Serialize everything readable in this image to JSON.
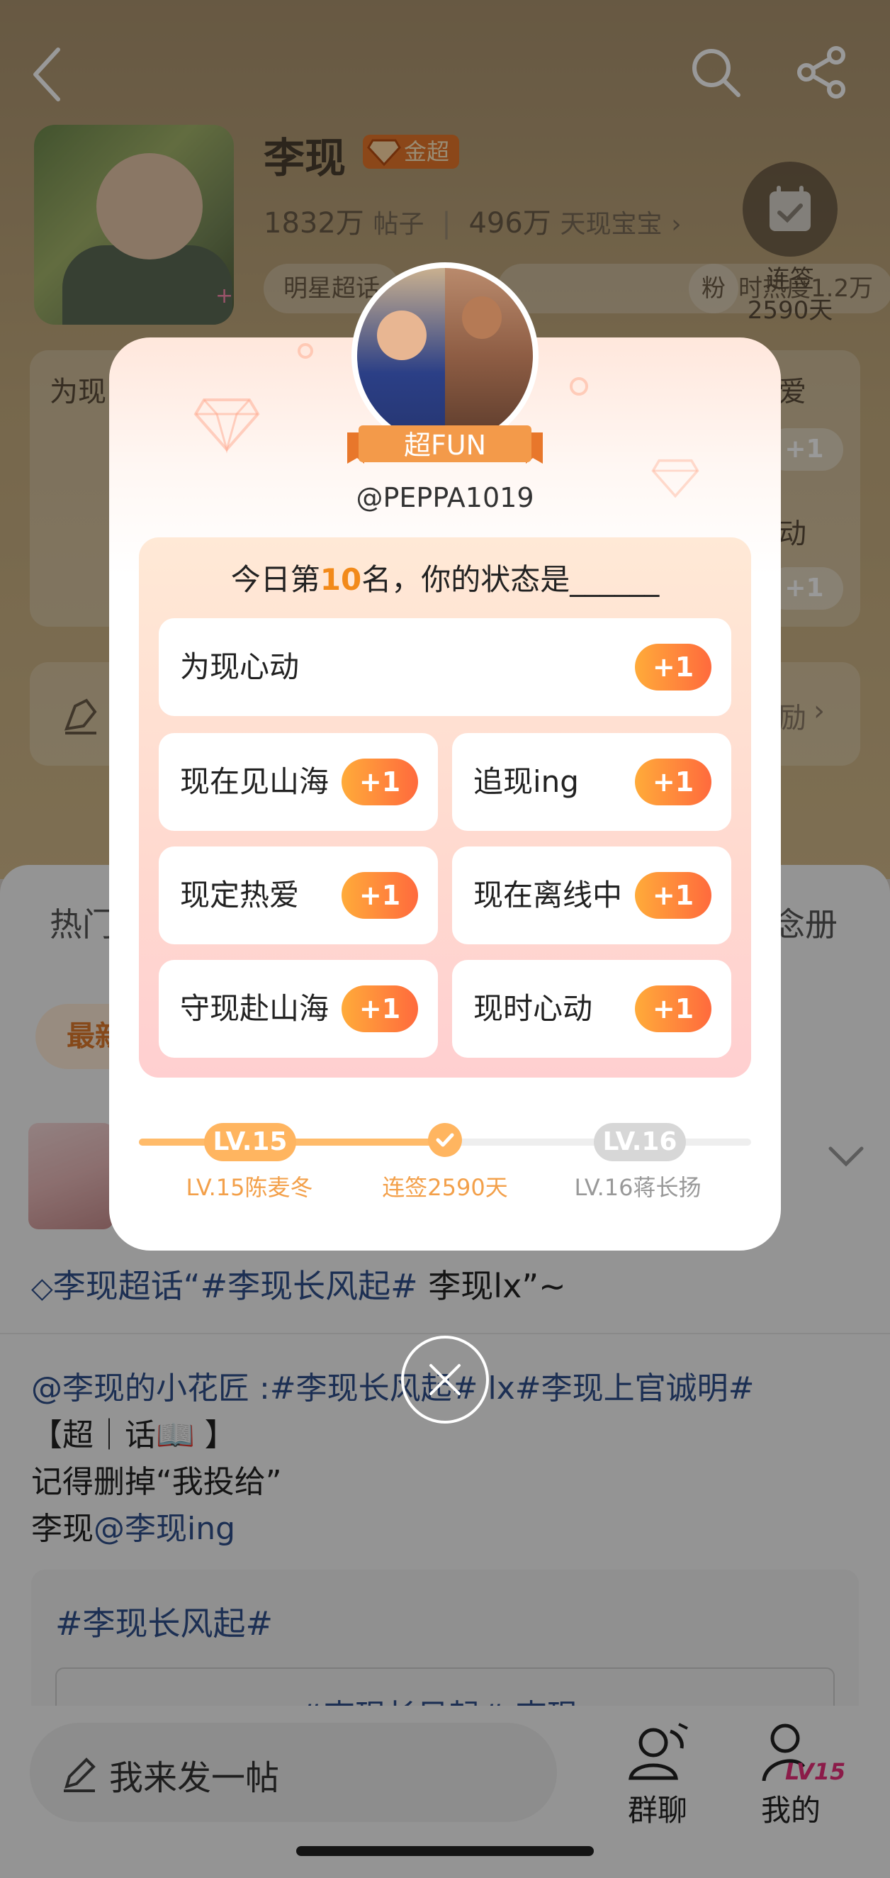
{
  "header": {
    "name": "李现",
    "badge": "金超",
    "posts_count": "1832万",
    "posts_label": "帖子",
    "fans_count": "496万",
    "fans_label": "天现宝宝",
    "pill_star": "明星超话",
    "pill_heat": "时热度1.2万",
    "pill_more": "粉",
    "checkin_label": "连签",
    "checkin_days": "2590天"
  },
  "background_cards": {
    "left_title": "为现",
    "right_top": "爱",
    "right_bottom": "动",
    "plus_one": "+1",
    "row2_right": "励"
  },
  "tabs": {
    "left": "热门",
    "right": "念册"
  },
  "chip_latest": "最新",
  "post": {
    "topic_prefix": "李现超话",
    "topic_tag": "“#李现长风起#",
    "topic_rest": " 李现lx”~",
    "body_line1_mention": "@李现的小花匠",
    "body_line1_rest": " :#李现长风起# lx#李现上官诚明#",
    "body_line2": "【超｜话📖 】",
    "body_line3": "记得删掉“我投给”",
    "body_line4_prefix": "李现",
    "body_line4_mention": "@李现ing",
    "card_title": "#李现长风起#",
    "card_box_text": "#李现长风起# 李现"
  },
  "bottom": {
    "compose_text": "我来发一帖",
    "group_label": "群聊",
    "mine_label": "我的",
    "mine_level": "LV15"
  },
  "modal": {
    "ribbon": "超FUN",
    "handle": "@PEPPA1019",
    "question_prefix": "今日第",
    "rank": "10",
    "question_suffix": "名，你的状态是______",
    "options": [
      {
        "label": "为现心动",
        "action": "+1"
      },
      {
        "label": "现在见山海",
        "action": "+1"
      },
      {
        "label": "追现ing",
        "action": "+1"
      },
      {
        "label": "现定热爱",
        "action": "+1"
      },
      {
        "label": "现在离线中",
        "action": "+1"
      },
      {
        "label": "守现赴山海",
        "action": "+1"
      },
      {
        "label": "现时心动",
        "action": "+1"
      }
    ],
    "level_current": "LV.15",
    "level_next": "LV.16",
    "level_progress": 0.5,
    "caption_current": "LV.15陈麦冬",
    "caption_days": "连签2590天",
    "caption_next": "LV.16蒋长扬"
  },
  "colors": {
    "accent_orange": "#ff7a3d",
    "rank_orange": "#f28a1a",
    "link_blue": "#2f4f8a",
    "gold_badge": "#e8772b"
  },
  "icons": [
    "back-icon",
    "search-icon",
    "share-icon",
    "calendar-check-icon",
    "diamond-icon",
    "edit-icon",
    "group-chat-icon",
    "user-level-icon",
    "close-icon",
    "check-icon",
    "chevron-down-icon"
  ]
}
